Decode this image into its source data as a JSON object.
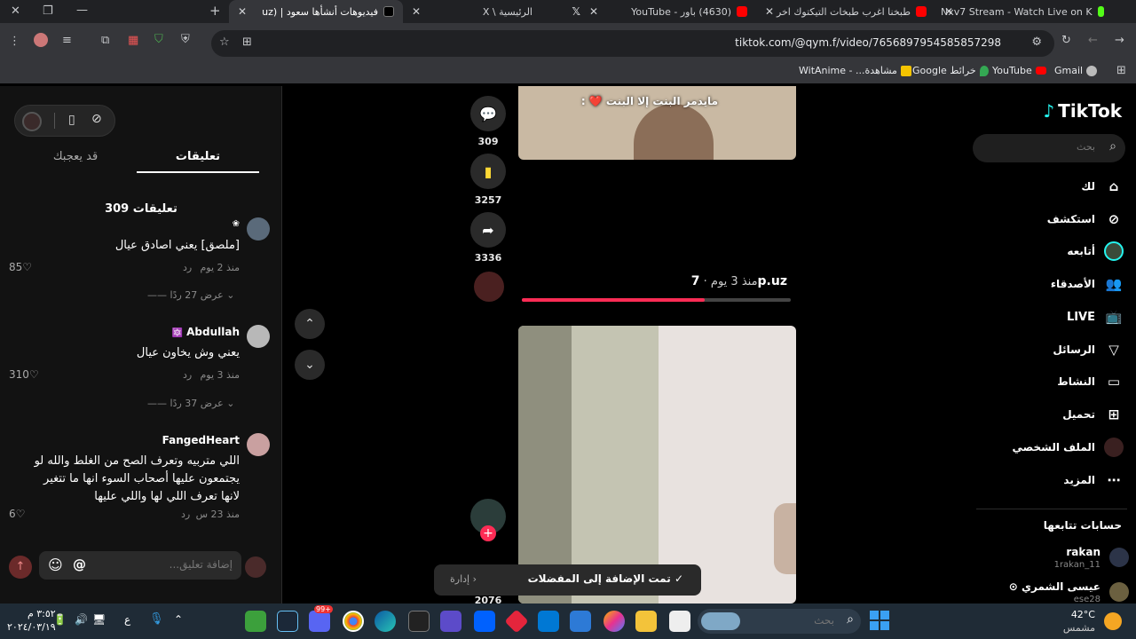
{
  "browser": {
    "tabs": [
      {
        "title": "Nxv7 Stream - Watch Live on K",
        "icon_color": "#53fc18"
      },
      {
        "title": "طبخنا اغرب طبخات التيكتوك اخر",
        "icon_color": "#ff0000"
      },
      {
        "title": "(4630) باور - YouTube",
        "icon_color": "#ff0000"
      },
      {
        "title": "X",
        "icon_color": "#ffffff"
      },
      {
        "title": "الرئيسية \\ X",
        "icon_color": "#ffffff"
      },
      {
        "title": "فيديوهات أنشأها سعود | (uz",
        "icon_color": "#ffffff"
      }
    ],
    "url": "tiktok.com/@qym.f/video/7656897954585857298",
    "bookmarks": [
      {
        "label": "Gmail",
        "color": "#bbbbbb"
      },
      {
        "label": "YouTube",
        "color": "#ff0000"
      },
      {
        "label": "خرائط Google",
        "color": "#34a853"
      },
      {
        "label": "مشاهدة... - WitAnime",
        "color": "#f5c400"
      }
    ]
  },
  "comments_panel": {
    "tab_comments": "تعليقات",
    "tab_liked": "قد يعجبك",
    "count_label": "309 تعليقات",
    "items": [
      {
        "username": "",
        "badge": "❀",
        "text": "[ملصق] يعني اصادق عيال",
        "time": "منذ 2 يوم",
        "reply": "رد",
        "likes": "85",
        "view_replies": "عرض 27 ردًا",
        "avatar_color": "#5a6a7a"
      },
      {
        "username": "Abdullah",
        "badge": "🔯",
        "text": "يعني وش يخاون عيال",
        "time": "منذ 3 يوم",
        "reply": "رد",
        "likes": "310",
        "view_replies": "عرض 37 ردًا",
        "avatar_color": "#b8b8b8"
      },
      {
        "username": "FangedHeart",
        "badge": "",
        "text": "اللي متربيه وتعرف الصح من الغلط والله لو يجتمعون عليها أصحاب السوء انها ما تتغير لانها تعرف اللي لها واللي عليها",
        "time": "منذ 23 س",
        "reply": "رد",
        "likes": "6",
        "view_replies": "",
        "avatar_color": "#c9a0a0"
      }
    ],
    "compose_placeholder": "إضافة تعليق..."
  },
  "video_feed": {
    "caption_overlay": "مايدمر البنت إلا البنت ❤️ :",
    "actions": {
      "comments": "309",
      "saves": "3257",
      "shares": "3336",
      "next": "2076"
    },
    "author": "7p.uz",
    "posted": "منذ 3 يوم",
    "progress": 0.68
  },
  "toast": {
    "message": "تمت الإضافة إلى المفضلات",
    "action": "إدارة"
  },
  "sidebar": {
    "logo": "TikTok",
    "search_placeholder": "بحث",
    "nav": [
      {
        "label": "لك",
        "icon": "home-icon"
      },
      {
        "label": "استكشف",
        "icon": "compass-icon"
      },
      {
        "label": "أتابعه",
        "icon": "following-avatar"
      },
      {
        "label": "الأصدقاء",
        "icon": "friends-icon"
      },
      {
        "label": "LIVE",
        "icon": "live-icon"
      },
      {
        "label": "الرسائل",
        "icon": "send-icon"
      },
      {
        "label": "النشاط",
        "icon": "inbox-icon"
      },
      {
        "label": "تحميل",
        "icon": "plus-square-icon"
      },
      {
        "label": "الملف الشخصي",
        "icon": "profile-avatar"
      },
      {
        "label": "المزيد",
        "icon": "more-icon"
      }
    ],
    "following_title": "حسابات تتابعها",
    "following": [
      {
        "name": "rakan",
        "handle": "1rakan_11"
      },
      {
        "name": "عيسى الشمري ⊙",
        "handle": "ese28"
      }
    ]
  },
  "taskbar": {
    "weather_temp": "42°C",
    "weather_label": "مشمس",
    "search_placeholder": "بحث",
    "time": "٣:٥٢ م",
    "date": "٢٠٢٤/٠٣/١٩",
    "lang": "ع",
    "notification_count": "99+"
  }
}
